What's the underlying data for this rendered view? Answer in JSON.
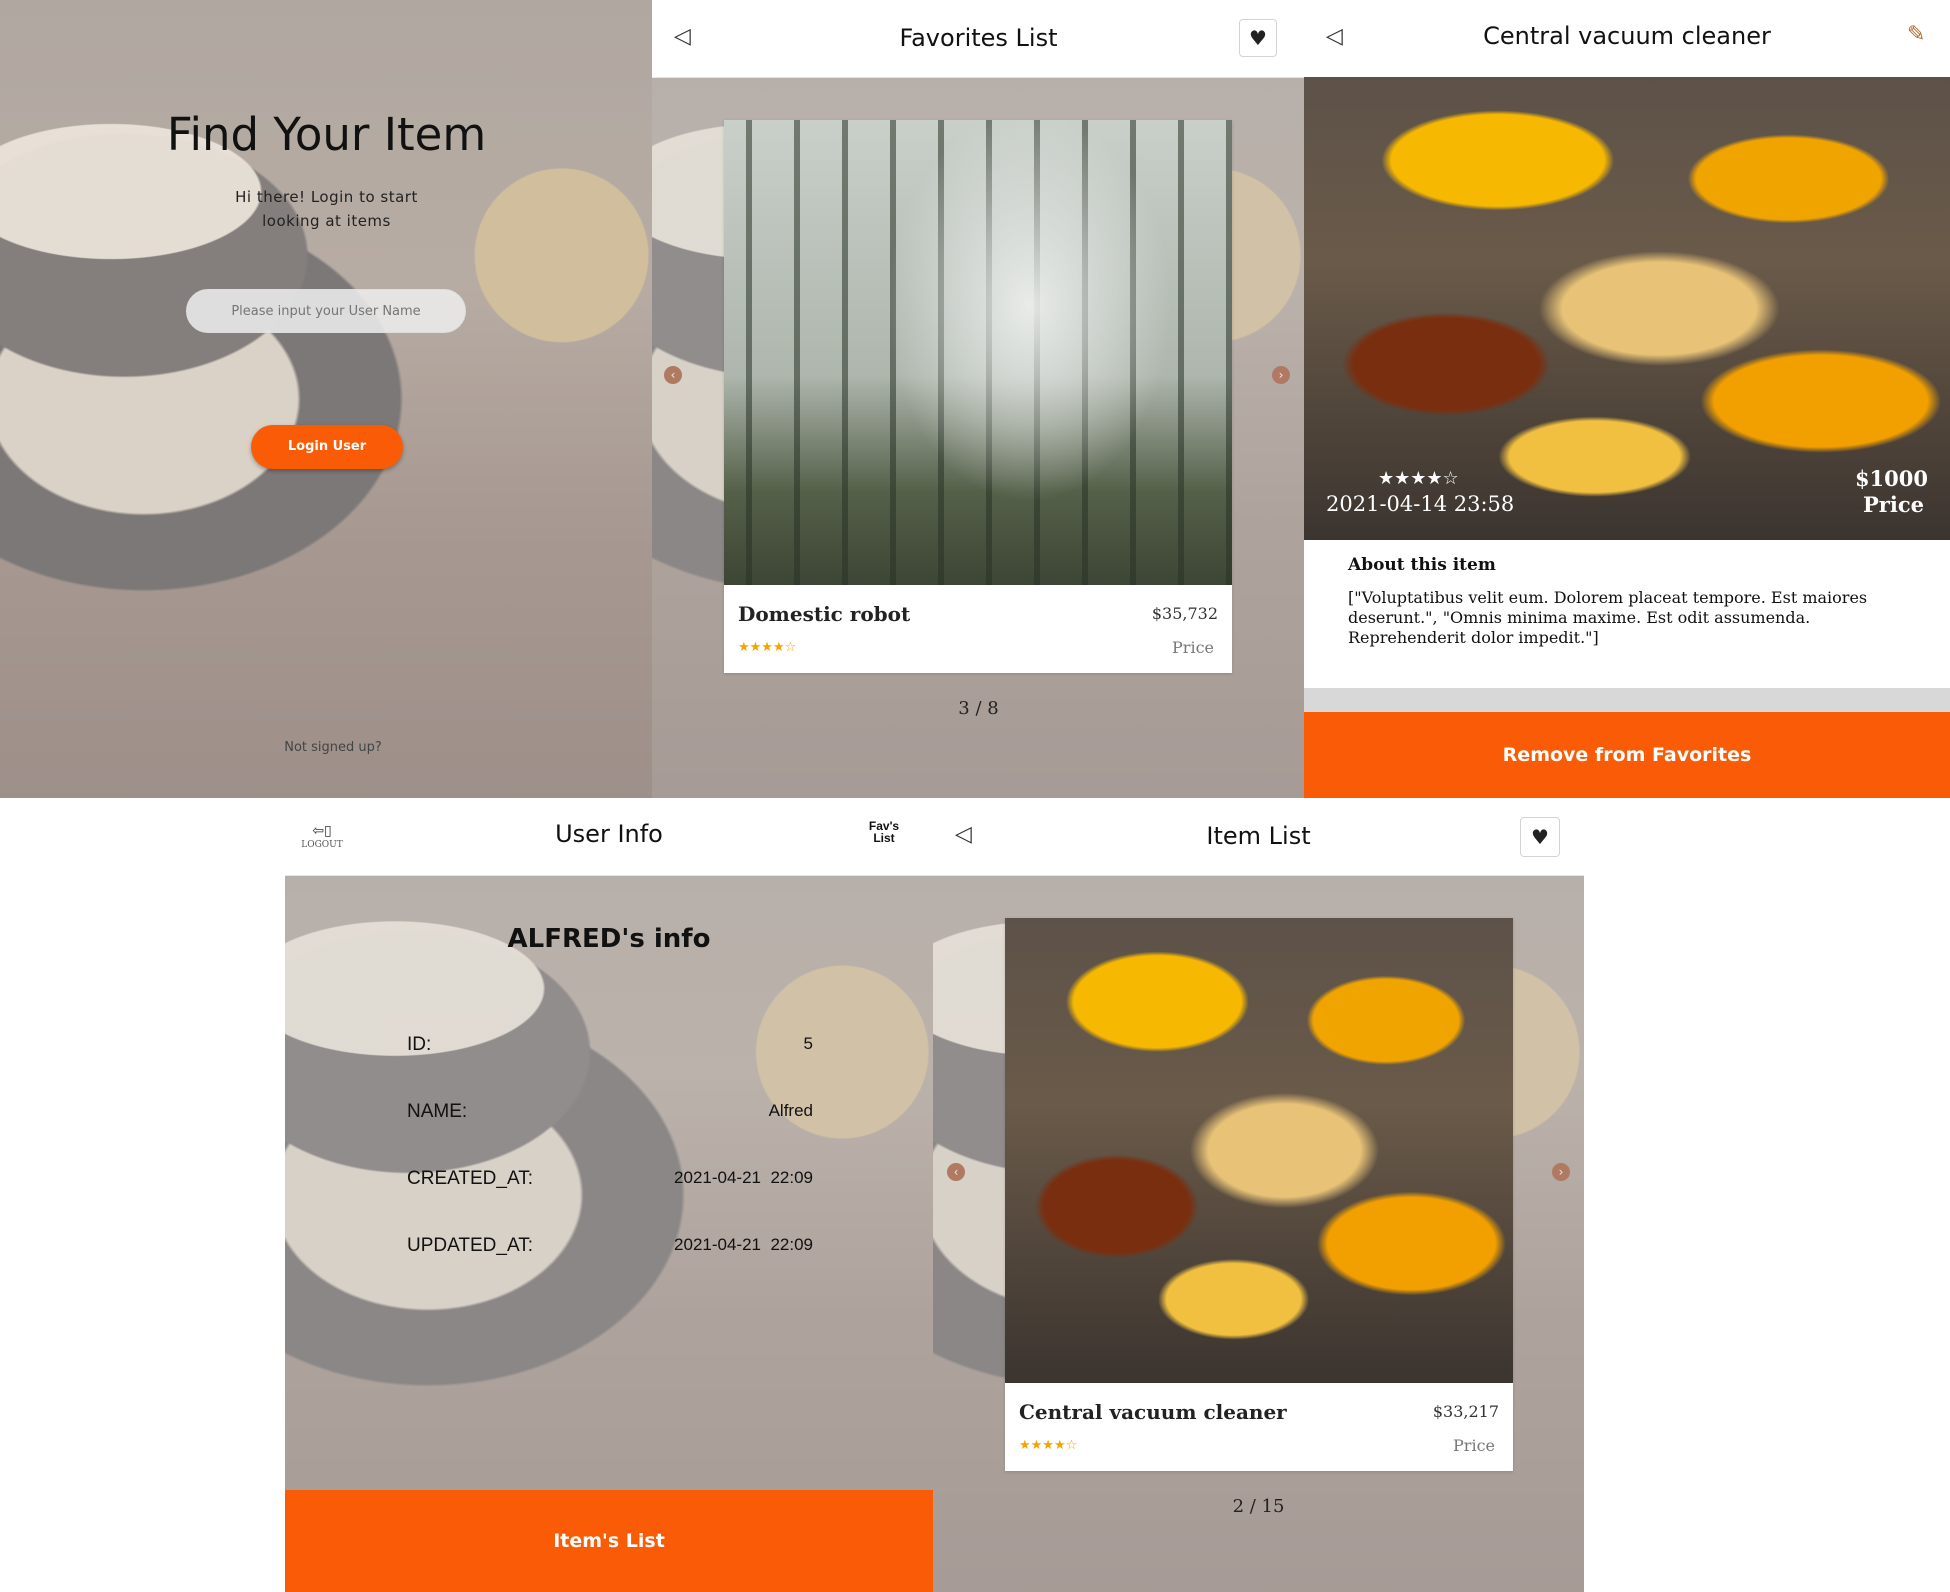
{
  "login": {
    "title": "Find Your Item",
    "subtitle_line1": "Hi there! Login to start",
    "subtitle_line2": "looking at items",
    "username_placeholder": "Please input your User Name",
    "login_button": "Login User",
    "signup_link": "Not signed up?"
  },
  "favorites": {
    "back_icon": "◁",
    "title": "Favorites List",
    "heart_icon": "♥",
    "card": {
      "name": "Domestic robot",
      "price": "$35,732",
      "price_label": "Price",
      "stars": "★★★★☆",
      "rating": 4
    },
    "pager": "3 / 8"
  },
  "detail": {
    "back_icon": "◁",
    "title": "Central vacuum cleaner",
    "edit_icon": "✎",
    "stars": "★★★★☆",
    "rating": 4,
    "date": "2021-04-14 23:58",
    "price": "$1000",
    "price_label": "Price",
    "about_heading": "About this item",
    "about_text": "[\"Voluptatibus velit eum. Dolorem placeat tempore. Est maiores deserunt.\", \"Omnis minima maxime. Est odit assumenda. Reprehenderit dolor impedit.\"]",
    "remove_button": "Remove from Favorites"
  },
  "user_info": {
    "logout_label": "LOGOUT",
    "title": "User Info",
    "favs_line1": "Fav's",
    "favs_line2": "List",
    "info_heading": "ALFRED's info",
    "fields": [
      {
        "label": "ID:",
        "value": "5"
      },
      {
        "label": "NAME:",
        "value": "Alfred"
      },
      {
        "label": "CREATED_AT:",
        "value": "2021-04-21  22:09"
      },
      {
        "label": "UPDATED_AT:",
        "value": "2021-04-21  22:09"
      }
    ],
    "items_button": "Item's List"
  },
  "item_list": {
    "back_icon": "◁",
    "title": "Item List",
    "heart_icon": "♥",
    "card": {
      "name": "Central vacuum cleaner",
      "price": "$33,217",
      "price_label": "Price",
      "stars": "★★★★☆",
      "rating": 4
    },
    "pager": "2 / 15"
  },
  "colors": {
    "accent": "#f95b07",
    "star": "#f5a300"
  }
}
